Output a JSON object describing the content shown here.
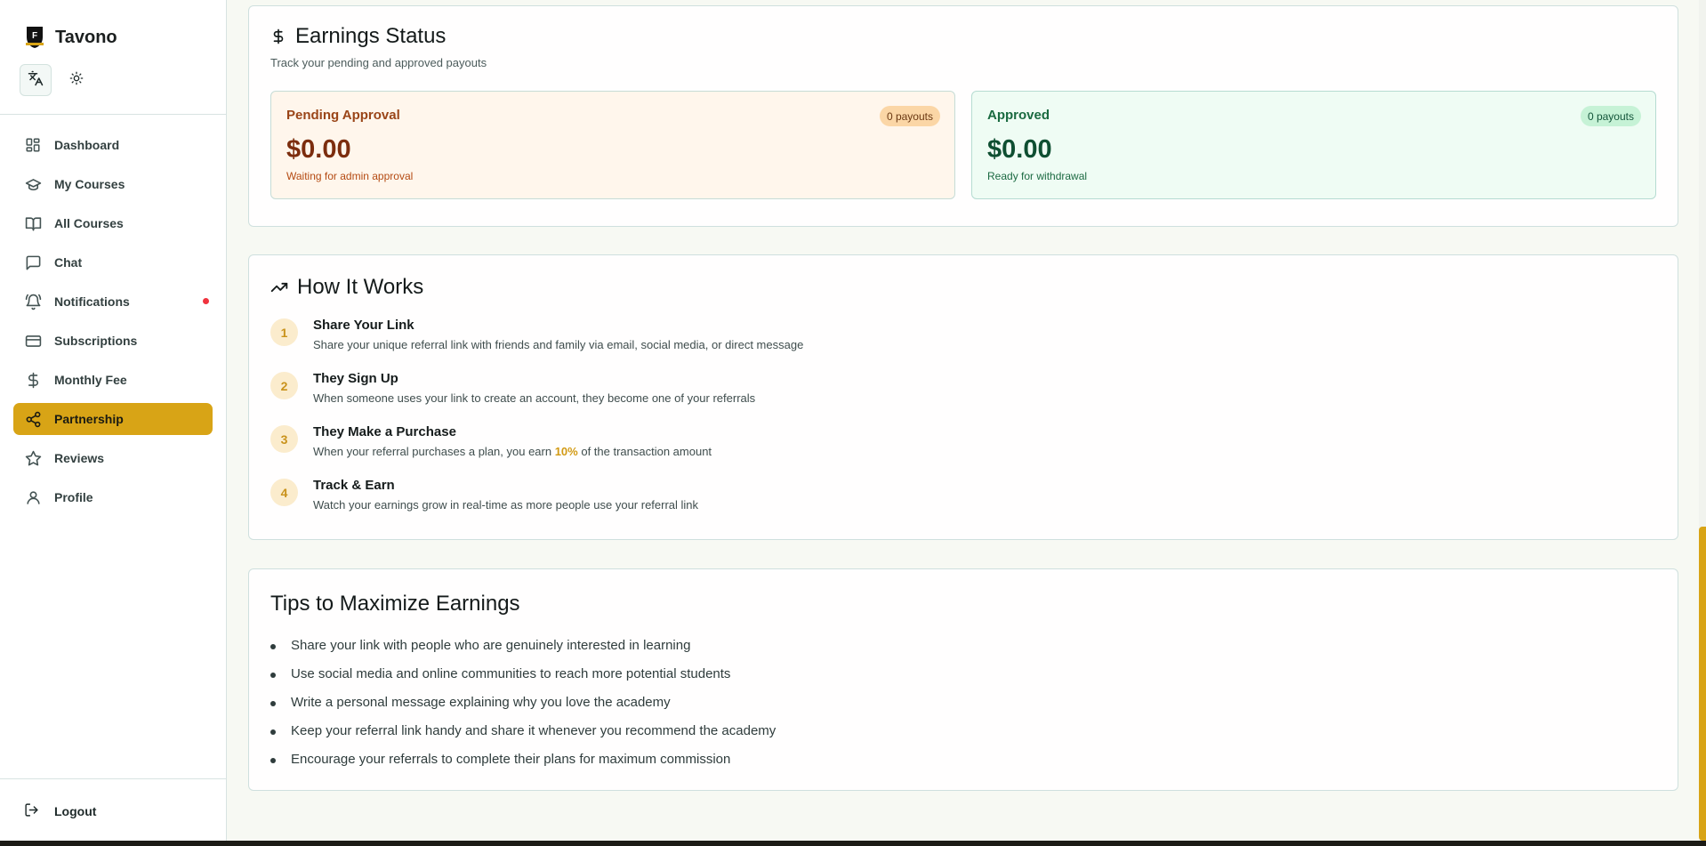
{
  "app": {
    "name": "Tavono",
    "logo_letter": "F"
  },
  "sidebar": {
    "items": [
      {
        "label": "Dashboard",
        "icon": "dashboard-icon"
      },
      {
        "label": "My Courses",
        "icon": "graduation-cap-icon"
      },
      {
        "label": "All Courses",
        "icon": "book-open-icon"
      },
      {
        "label": "Chat",
        "icon": "chat-icon"
      },
      {
        "label": "Notifications",
        "icon": "bell-icon",
        "has_dot": true
      },
      {
        "label": "Subscriptions",
        "icon": "credit-card-icon"
      },
      {
        "label": "Monthly Fee",
        "icon": "dollar-icon"
      },
      {
        "label": "Partnership",
        "icon": "share-icon",
        "active": true
      },
      {
        "label": "Reviews",
        "icon": "star-icon"
      },
      {
        "label": "Profile",
        "icon": "user-icon"
      }
    ],
    "logout_label": "Logout"
  },
  "earnings": {
    "title": "Earnings Status",
    "subtitle": "Track your pending and approved payouts",
    "pending": {
      "title": "Pending Approval",
      "badge": "0 payouts",
      "amount": "$0.00",
      "note": "Waiting for admin approval"
    },
    "approved": {
      "title": "Approved",
      "badge": "0 payouts",
      "amount": "$0.00",
      "note": "Ready for withdrawal"
    }
  },
  "how": {
    "title": "How It Works",
    "steps": [
      {
        "num": "1",
        "title": "Share Your Link",
        "desc": "Share your unique referral link with friends and family via email, social media, or direct message"
      },
      {
        "num": "2",
        "title": "They Sign Up",
        "desc": "When someone uses your link to create an account, they become one of your referrals"
      },
      {
        "num": "3",
        "title": "They Make a Purchase",
        "desc_before": "When your referral purchases a plan, you earn ",
        "desc_highlight": "10%",
        "desc_after": " of the transaction amount"
      },
      {
        "num": "4",
        "title": "Track & Earn",
        "desc": "Watch your earnings grow in real-time as more people use your referral link"
      }
    ]
  },
  "tips": {
    "title": "Tips to Maximize Earnings",
    "items": [
      "Share your link with people who are genuinely interested in learning",
      "Use social media and online communities to reach more potential students",
      "Write a personal message explaining why you love the academy",
      "Keep your referral link handy and share it whenever you recommend the academy",
      "Encourage your referrals to complete their plans for maximum commission"
    ]
  },
  "colors": {
    "accent": "#d8a416",
    "pending_bg": "#fff6ec",
    "approved_bg": "#effcf4",
    "notification_dot": "#f0333e"
  }
}
